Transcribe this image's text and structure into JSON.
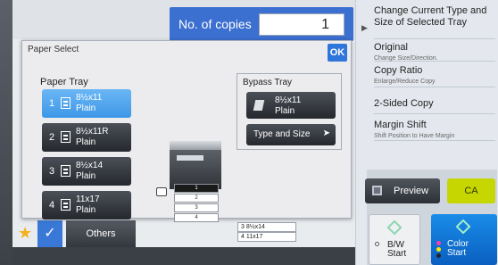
{
  "header": {
    "copies_label": "No. of copies",
    "copies_value": "1"
  },
  "dialog": {
    "title": "Paper Select",
    "ok_label": "OK",
    "paper_tray_label": "Paper Tray",
    "trays": [
      {
        "number": "1",
        "size": "8½x11",
        "type": "Plain",
        "selected": true
      },
      {
        "number": "2",
        "size": "8½x11R",
        "type": "Plain",
        "selected": false
      },
      {
        "number": "3",
        "size": "8½x14",
        "type": "Plain",
        "selected": false
      },
      {
        "number": "4",
        "size": "11x17",
        "type": "Plain",
        "selected": false
      }
    ],
    "bypass": {
      "label": "Bypass Tray",
      "size": "8½x11",
      "type": "Plain",
      "type_and_size_label": "Type and Size"
    },
    "machine_slots": [
      "1",
      "2",
      "3",
      "4"
    ]
  },
  "right_panel": {
    "items": [
      {
        "main": "Change Current Type and Size of Selected Tray",
        "sub": ""
      },
      {
        "main": "Original",
        "sub": "Change Size/Direction."
      },
      {
        "main": "Copy Ratio",
        "sub": "Enlarge/Reduce Copy"
      },
      {
        "main": "2-Sided Copy",
        "sub": ""
      },
      {
        "main": "Margin Shift",
        "sub": "Shift Position to Have Margin"
      }
    ],
    "preview_label": "Preview",
    "ca_label": "CA",
    "bw_start_line1": "B/W",
    "bw_start_line2": "Start",
    "color_start_line1": "Color",
    "color_start_line2": "Start"
  },
  "bottom": {
    "others_label": "Others",
    "tray3_label": "3  8½x14",
    "tray4_label": "4  11x17"
  },
  "colors": {
    "accent_blue": "#3b6fd0",
    "selected_tray": "#4aa3ec",
    "ca_green": "#c5d600",
    "color_start": "#0a6fd6"
  }
}
